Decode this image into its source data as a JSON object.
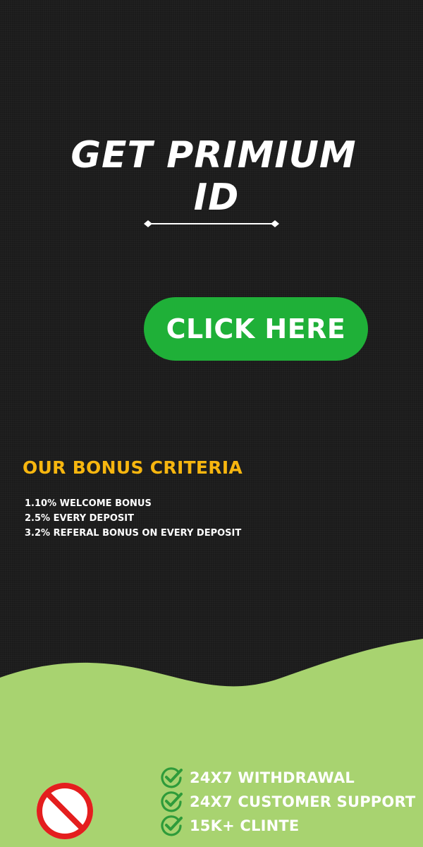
{
  "hero": {
    "title_line1": "GET PRIMIUM",
    "title_line2": "ID"
  },
  "cta": {
    "label": "CLICK HERE"
  },
  "bonus": {
    "title": "OUR BONUS CRITERIA",
    "items": [
      "1.10% WELCOME BONUS",
      "2.5% EVERY DEPOSIT",
      "3.2% REFERAL BONUS ON EVERY DEPOSIT"
    ]
  },
  "features": [
    {
      "label": "24X7 WITHDRAWAL",
      "icon": "check-circle-icon"
    },
    {
      "label": "24X7 CUSTOMER SUPPORT",
      "icon": "check-circle-icon"
    },
    {
      "label": "15K+ CLINTE",
      "icon": "check-circle-icon"
    }
  ],
  "icons": {
    "divider": "diamond-line-divider",
    "prohibited": "no-entry-icon"
  },
  "colors": {
    "background": "#1b1b1b",
    "cta_green": "#1fb038",
    "bonus_title_yellow": "#f7b60f",
    "wave_green": "#a8d370",
    "check_green": "#2e9b3a",
    "ban_red": "#e41e1e"
  }
}
